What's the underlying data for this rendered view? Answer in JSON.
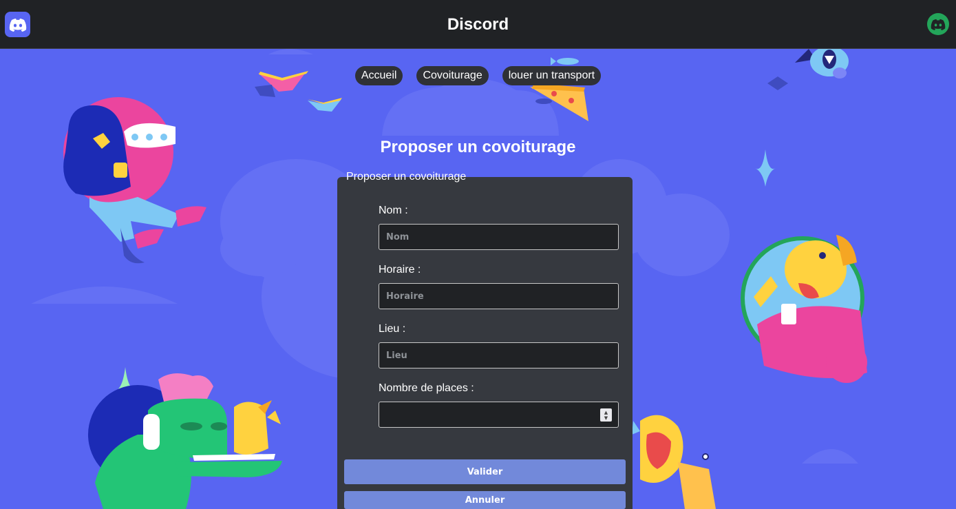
{
  "header": {
    "title": "Discord",
    "logo_icon": "discord-logo-icon",
    "avatar_icon": "discord-avatar-icon",
    "avatar_color": "#23a55a"
  },
  "nav": {
    "items": [
      {
        "label": "Accueil"
      },
      {
        "label": "Covoiturage"
      },
      {
        "label": "louer un transport"
      }
    ]
  },
  "page": {
    "title": "Proposer un covoiturage"
  },
  "form": {
    "legend": "Proposer un covoiturage",
    "fields": {
      "nom": {
        "label": "Nom :",
        "placeholder": "Nom",
        "value": ""
      },
      "horaire": {
        "label": "Horaire :",
        "placeholder": "Horaire",
        "value": ""
      },
      "lieu": {
        "label": "Lieu :",
        "placeholder": "Lieu",
        "value": ""
      },
      "places": {
        "label": "Nombre de places :",
        "placeholder": "",
        "value": ""
      }
    },
    "submit_label": "Valider",
    "cancel_label": "Annuler"
  },
  "colors": {
    "background": "#5865f2",
    "header": "#202225",
    "card": "#36393f",
    "button": "#7289da"
  }
}
